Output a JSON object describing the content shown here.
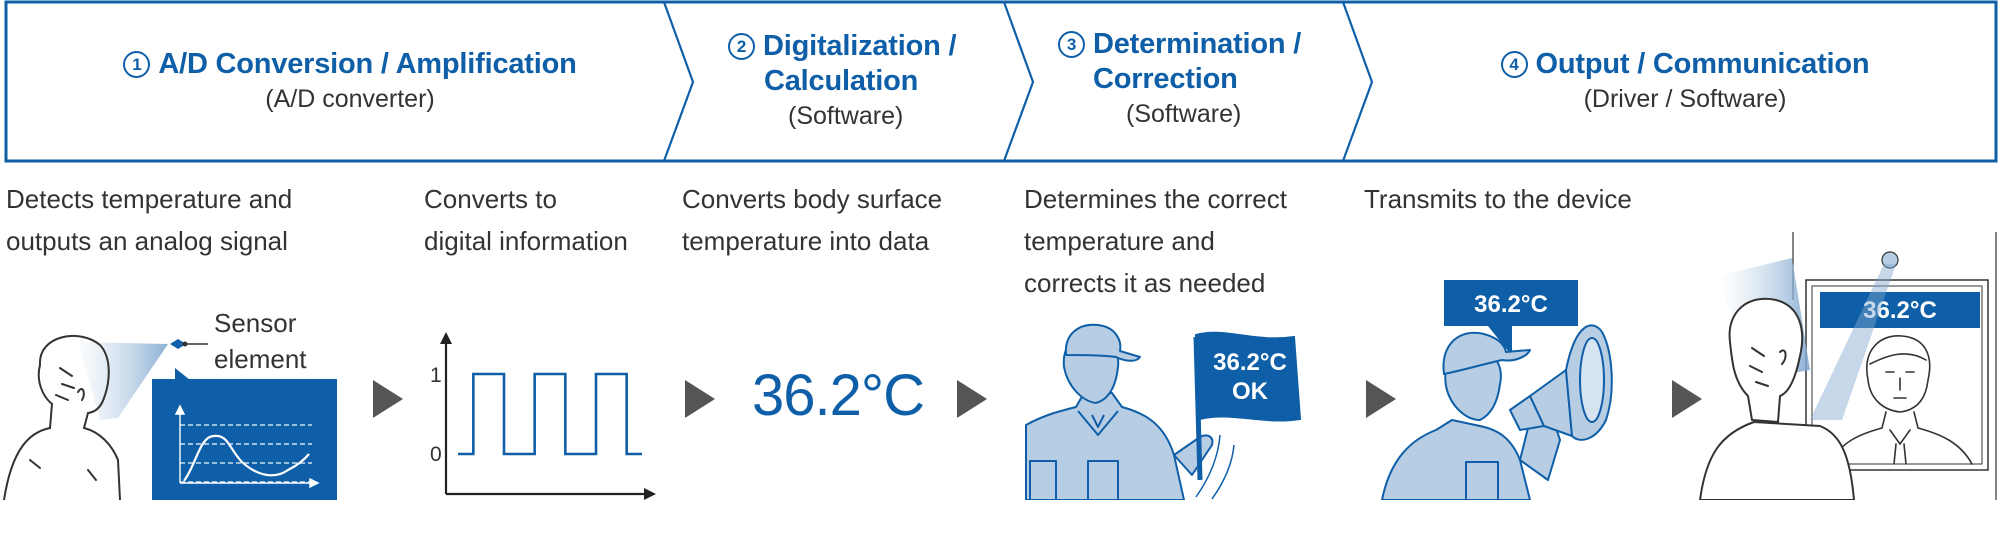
{
  "colors": {
    "brand_blue": "#0f5fa8",
    "light_blue": "#b7cde3",
    "arrow_gray": "#555555",
    "text": "#333333"
  },
  "steps": [
    {
      "number": "1",
      "title_lines": [
        "A/D Conversion / Amplification"
      ],
      "subtitle": "(A/D converter)",
      "description_lines": [
        "Detects temperature and",
        "outputs an analog signal"
      ]
    },
    {
      "number": "2",
      "title_lines": [
        "Digitalization /",
        "Calculation"
      ],
      "subtitle": "(Software)",
      "description_lines": [
        "Converts body surface",
        "temperature into data"
      ]
    },
    {
      "number": "3",
      "title_lines": [
        "Determination /",
        "Correction"
      ],
      "subtitle": "(Software)",
      "description_lines": [
        "Determines the correct",
        "temperature and",
        "corrects it as needed"
      ]
    },
    {
      "number": "4",
      "title_lines": [
        "Output / Communication"
      ],
      "subtitle": "(Driver / Software)",
      "description_lines": [
        "Transmits to the device"
      ]
    }
  ],
  "extra_description": {
    "lines": [
      "Converts to",
      "digital information"
    ]
  },
  "illustrations": {
    "sensor_label_lines": [
      "Sensor",
      "element"
    ],
    "analog_graph": {
      "type": "line",
      "description": "analog sensor signal waveform"
    },
    "digital_graph": {
      "type": "line",
      "y_ticks": [
        "1",
        "0"
      ],
      "signal": [
        0,
        1,
        1,
        0,
        0,
        1,
        1,
        0,
        0,
        1,
        1,
        0
      ]
    },
    "temperature_value": "36.2°C",
    "flag_lines": [
      "36.2°C",
      "OK"
    ],
    "speech_bubble": "36.2°C",
    "display_value": "36.2°C"
  },
  "icons": [
    "play-arrow-icon",
    "person-icon",
    "sensor-icon",
    "worker-icon",
    "flag-icon",
    "megaphone-icon",
    "camera-icon",
    "monitor-icon"
  ]
}
